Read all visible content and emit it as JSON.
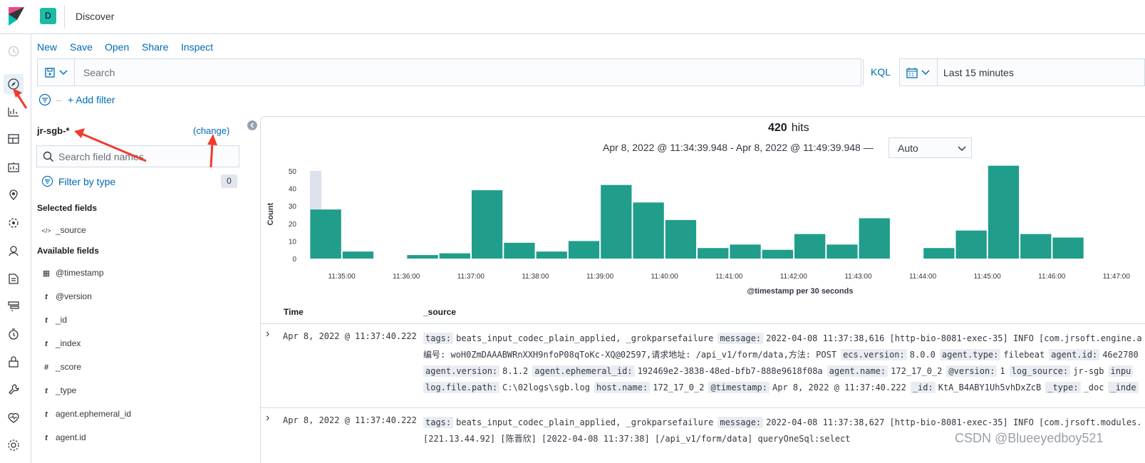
{
  "app": {
    "space_letter": "D",
    "title": "Discover"
  },
  "sidenav": {
    "icons": [
      "clock-icon",
      "compass-icon",
      "chart-icon",
      "dashboard-icon",
      "canvas-icon",
      "maps-icon",
      "ml-icon",
      "user-icon",
      "siem-icon",
      "logs-icon",
      "uptime-icon",
      "lock-icon",
      "dev-tools-icon",
      "monitoring-icon",
      "gear-icon"
    ]
  },
  "menu": {
    "new": "New",
    "save": "Save",
    "open": "Open",
    "share": "Share",
    "inspect": "Inspect"
  },
  "query": {
    "placeholder": "Search",
    "language": "KQL"
  },
  "time": {
    "label": "Last 15 minutes"
  },
  "filters": {
    "add_label": "+ Add filter"
  },
  "sidebar": {
    "index_pattern": "jr-sgb-*",
    "change_label": "(change)",
    "field_search_placeholder": "Search field names",
    "filter_by_type": "Filter by type",
    "filter_count": "0",
    "selected_title": "Selected fields",
    "selected_fields": [
      {
        "type_glyph": "</>",
        "name": "_source"
      }
    ],
    "available_title": "Available fields",
    "available_fields": [
      {
        "type_glyph": "▦",
        "name": "@timestamp"
      },
      {
        "type_glyph": "t",
        "name": "@version"
      },
      {
        "type_glyph": "t",
        "name": "_id"
      },
      {
        "type_glyph": "t",
        "name": "_index"
      },
      {
        "type_glyph": "#",
        "name": "_score"
      },
      {
        "type_glyph": "t",
        "name": "_type"
      },
      {
        "type_glyph": "t",
        "name": "agent.ephemeral_id"
      },
      {
        "type_glyph": "t",
        "name": "agent.id"
      }
    ]
  },
  "results": {
    "hits": "420",
    "hits_label": "hits",
    "range_text": "Apr 8, 2022 @ 11:34:39.948 - Apr 8, 2022 @ 11:49:39.948 —",
    "interval": "Auto",
    "col_time": "Time",
    "col_source": "_source"
  },
  "chart_data": {
    "type": "bar",
    "ylabel": "Count",
    "xlabel": "@timestamp per 30 seconds",
    "ylim": [
      0,
      50
    ],
    "yticks": [
      0,
      10,
      20,
      30,
      40,
      50
    ],
    "xticks": [
      "11:35:00",
      "11:36:00",
      "11:37:00",
      "11:38:00",
      "11:39:00",
      "11:40:00",
      "11:41:00",
      "11:42:00",
      "11:43:00",
      "11:44:00",
      "11:45:00",
      "11:46:00",
      "11:47:00"
    ],
    "categories": [
      "11:34:30",
      "11:35:00",
      "11:35:30",
      "11:36:00",
      "11:36:30",
      "11:37:00",
      "11:37:30",
      "11:38:00",
      "11:38:30",
      "11:39:00",
      "11:39:30",
      "11:40:00",
      "11:40:30",
      "11:41:00",
      "11:41:30",
      "11:42:00",
      "11:42:30",
      "11:43:00",
      "11:43:30",
      "11:44:00",
      "11:44:30",
      "11:45:00",
      "11:45:30",
      "11:46:00",
      "11:46:30"
    ],
    "values": [
      28,
      4,
      0,
      2,
      3,
      39,
      9,
      4,
      10,
      42,
      32,
      22,
      6,
      8,
      5,
      14,
      8,
      23,
      0,
      6,
      16,
      53,
      14,
      12,
      0
    ],
    "bar_color": "#209d8b"
  },
  "rows": [
    {
      "time": "Apr 8, 2022 @ 11:37:40.222",
      "lines": [
        [
          [
            "tags:",
            "beats_input_codec_plain_applied, _grokparsefailure"
          ],
          [
            "message:",
            "2022-04-08 11:37:38,616 [http-bio-8081-exec-35] INFO [com.jrsoft.engine.a"
          ]
        ],
        [
          [
            "",
            "编号: woH0ZmDAAABWRnXXH9nfoP08qToKc-XQ@02597,请求地址: /api_v1/form/data,方法: POST"
          ],
          [
            "ecs.version:",
            "8.0.0"
          ],
          [
            "agent.type:",
            "filebeat"
          ],
          [
            "agent.id:",
            "46e2780"
          ]
        ],
        [
          [
            "agent.version:",
            "8.1.2"
          ],
          [
            "agent.ephemeral_id:",
            "192469e2-3838-48ed-bfb7-888e9618f08a"
          ],
          [
            "agent.name:",
            "172_17_0_2"
          ],
          [
            "@version:",
            "1"
          ],
          [
            "log_source:",
            "jr-sgb"
          ],
          [
            "inpu",
            ""
          ]
        ],
        [
          [
            "log.file.path:",
            "C:\\02logs\\sgb.log"
          ],
          [
            "host.name:",
            "172_17_0_2"
          ],
          [
            "@timestamp:",
            "Apr 8, 2022 @ 11:37:40.222"
          ],
          [
            "_id:",
            "KtA_B4ABY1Uh5vhDxZcB"
          ],
          [
            "_type:",
            "_doc"
          ],
          [
            "_inde",
            ""
          ]
        ]
      ]
    },
    {
      "time": "Apr 8, 2022 @ 11:37:40.222",
      "lines": [
        [
          [
            "tags:",
            "beats_input_codec_plain_applied, _grokparsefailure"
          ],
          [
            "message:",
            "2022-04-08 11:37:38,627 [http-bio-8081-exec-35] INFO [com.jrsoft.modules."
          ]
        ],
        [
          [
            "",
            "[221.13.44.92] [陈晋欣] [2022-04-08 11:37:38] [/api_v1/form/data] queryOneSql:select"
          ]
        ]
      ]
    }
  ],
  "watermark": "CSDN @Blueeyedboy521",
  "accent": "#006bb4",
  "annotation_color": "#f03c2e"
}
